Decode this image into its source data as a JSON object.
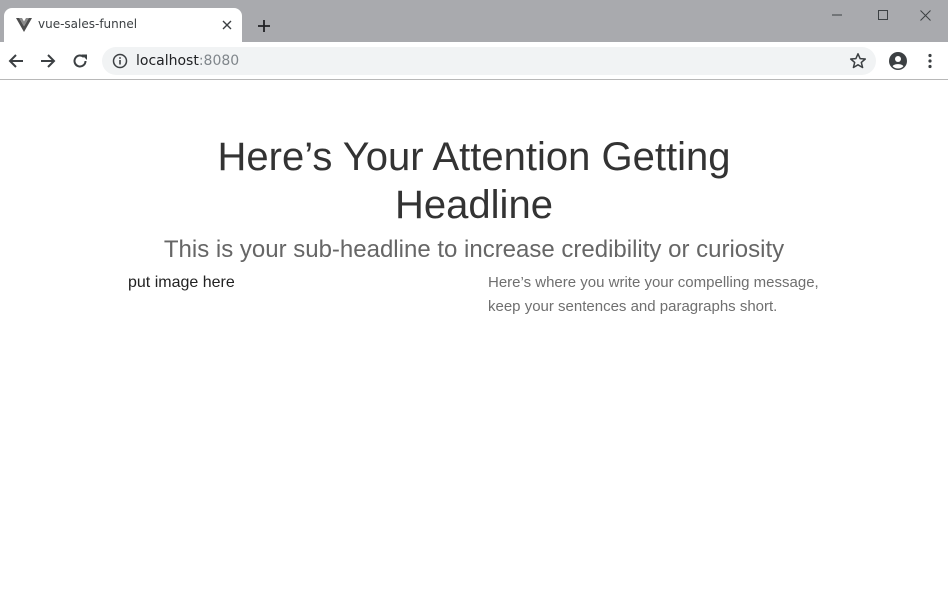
{
  "browser": {
    "tab": {
      "title": "vue-sales-funnel"
    },
    "address_bar": {
      "host": "localhost",
      "port": ":8080"
    }
  },
  "page": {
    "headline": "Here’s Your Attention Getting Headline",
    "subheadline": "This is your sub-headline to increase credibility or curiosity",
    "image_placeholder": "put image here",
    "message": "Here’s where you write your compelling message, keep your sentences and paragraphs short."
  },
  "colors": {
    "tab_strip": "#a9aaae",
    "headline": "#333333",
    "subheadline": "#666666",
    "message": "#6f6f6f"
  }
}
